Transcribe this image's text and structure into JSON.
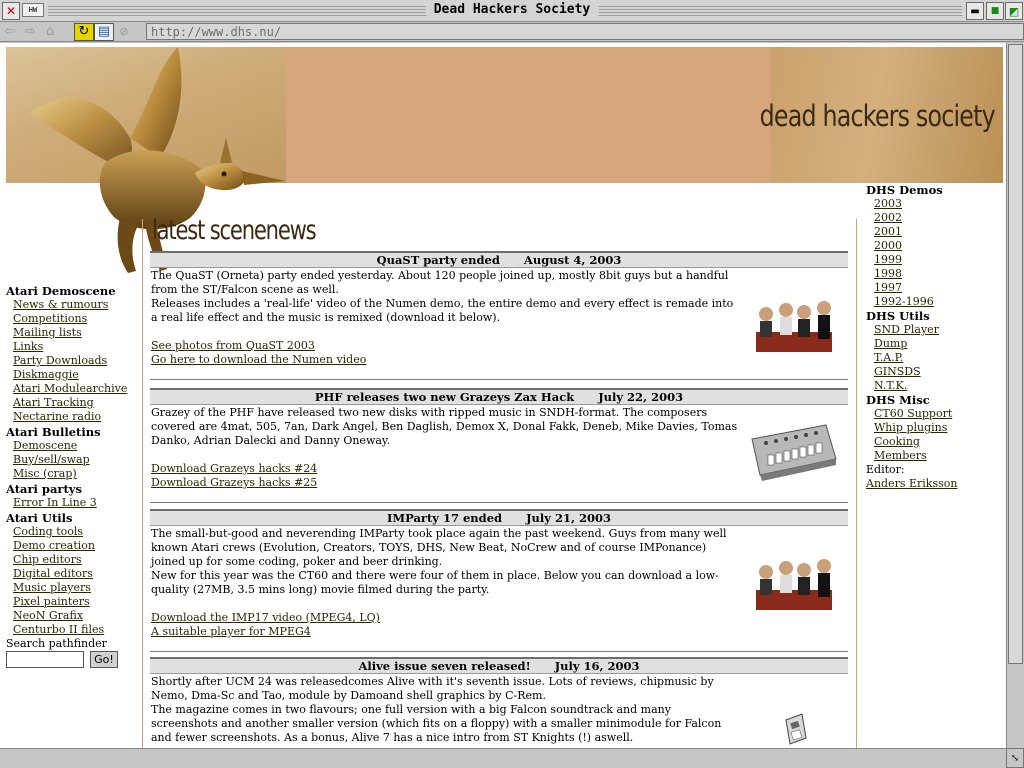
{
  "window": {
    "title": "Dead Hackers Society",
    "mini_label": "HW",
    "url": "http://www.dhs.nu/"
  },
  "banner": {
    "site_name": "dead hackers society"
  },
  "page_heading": "latest scenenews",
  "left_nav": {
    "sections": [
      {
        "title": "Atari Demoscene",
        "items": [
          "News & rumours",
          "Competitions",
          "Mailing lists",
          "Links",
          "Party Downloads",
          "Diskmaggie",
          "Atari Modulearchive",
          "Atari Tracking",
          "Nectarine radio"
        ]
      },
      {
        "title": "Atari Bulletins",
        "items": [
          "Demoscene",
          "Buy/sell/swap",
          "Misc (crap)"
        ]
      },
      {
        "title": "Atari partys",
        "items": [
          "Error In Line 3"
        ]
      },
      {
        "title": "Atari Utils",
        "items": [
          "Coding tools",
          "Demo creation",
          "Chip editors",
          "Digital editors",
          "Music players",
          "Pixel painters",
          "NeoN Grafix",
          "Centurbo II files"
        ]
      }
    ],
    "search_label": "Search pathfinder",
    "search_button": "Go!"
  },
  "news": [
    {
      "title": "QuaST party ended",
      "date": "August 4, 2003",
      "lines": [
        "The QuaST (Orneta) party ended yesterday. About 120 people joined up, mostly 8bit guys but a handful from the ST/Falcon scene as well.",
        "Releases includes a 'real-life' video of the Numen demo, the entire demo and every effect is remade into a real life effect and the music is remixed (download it below)."
      ],
      "links": [
        "See photos from QuaST 2003",
        "Go here to download the Numen video"
      ]
    },
    {
      "title": "PHF releases two new Grazeys Zax Hack",
      "date": "July 22, 2003",
      "lines": [
        "Grazey of the PHF have released two new disks with ripped music in SNDH-format. The composers covered are 4mat, 505, 7an, Dark Angel, Ben Daglish, Demox X, Donal Fakk, Deneb, Mike Davies, Tomas Danko, Adrian Dalecki and Danny Oneway."
      ],
      "links": [
        "Download Grazeys hacks #24",
        "Download Grazeys hacks #25"
      ]
    },
    {
      "title": "IMParty 17 ended",
      "date": "July 21, 2003",
      "lines": [
        "The small-but-good and neverending IMParty took place again the past weekend. Guys from many well known Atari crews (Evolution, Creators, TOYS, DHS, New Beat, NoCrew and of course IMPonance) joined up for some coding, poker and beer drinking.",
        "New for this year was the CT60 and there were four of them in place. Below you can download a low-quality (27MB, 3.5 mins long) movie filmed during the party."
      ],
      "links": [
        "Download the IMP17 video (MPEG4, LQ)",
        "A suitable player for MPEG4"
      ]
    },
    {
      "title": "Alive issue seven released!",
      "date": "July 16, 2003",
      "lines": [
        "Shortly after UCM 24 was releasedcomes Alive with it's seventh issue. Lots of reviews, chipmusic by Nemo, Dma-Sc and Tao, module by Damoand shell graphics by C-Rem.",
        "The magazine comes in two flavours; one full version with a big Falcon soundtrack and many screenshots and another smaller version (which fits on a floppy) with a smaller minimodule for Falcon and fewer screenshots. As a bonus, Alive 7 has a nice intro from ST Knights (!) aswell."
      ],
      "links": []
    }
  ],
  "right_nav": {
    "demos_title": "DHS Demos",
    "demos": [
      "2003",
      "2002",
      "2001",
      "2000",
      "1999",
      "1998",
      "1997",
      "1992-1996"
    ],
    "utils_title": "DHS Utils",
    "utils": [
      "SND Player",
      "Dump",
      "T.A.P.",
      "GINSDS",
      "N.T.K."
    ],
    "misc_title": "DHS Misc",
    "misc": [
      "CT60 Support",
      "Whip plugins",
      "Cooking",
      "Members"
    ],
    "editor_label": "Editor:",
    "editor_name": "Anders Eriksson"
  }
}
